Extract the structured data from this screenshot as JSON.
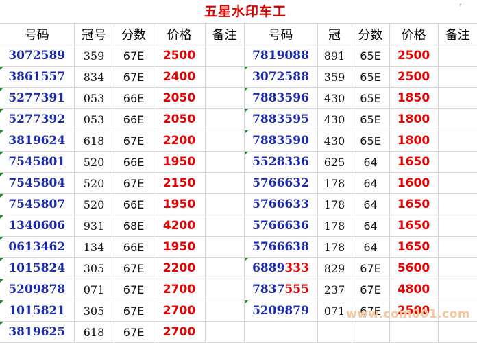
{
  "title": "五星水印车工",
  "headers_left": [
    "号码",
    "冠号",
    "分数",
    "价格",
    "备注"
  ],
  "headers_right": [
    "号码",
    "冠",
    "分数",
    "价格",
    "备注"
  ],
  "left_rows": [
    {
      "number": "3072589",
      "crown": "359",
      "score": "67E",
      "price": "2500"
    },
    {
      "number": "3861557",
      "crown": "834",
      "score": "67E",
      "price": "2400"
    },
    {
      "number": "5277391",
      "crown": "053",
      "score": "66E",
      "price": "2050"
    },
    {
      "number": "5277392",
      "crown": "053",
      "score": "66E",
      "price": "2050"
    },
    {
      "number": "3819624",
      "crown": "618",
      "score": "67E",
      "price": "2200"
    },
    {
      "number": "7545801",
      "crown": "520",
      "score": "66E",
      "price": "1950"
    },
    {
      "number": "7545804",
      "crown": "520",
      "score": "67E",
      "price": "2150"
    },
    {
      "number": "7545807",
      "crown": "520",
      "score": "66E",
      "price": "1950"
    },
    {
      "number": "1340606",
      "crown": "931",
      "score": "68E",
      "price": "4200"
    },
    {
      "number": "0613462",
      "crown": "134",
      "score": "66E",
      "price": "1950"
    },
    {
      "number": "1015824",
      "crown": "305",
      "score": "67E",
      "price": "2200"
    },
    {
      "number": "5209878",
      "crown": "071",
      "score": "67E",
      "price": "2700"
    },
    {
      "number": "1015821",
      "crown": "305",
      "score": "67E",
      "price": "2700"
    },
    {
      "number": "3819625",
      "crown": "618",
      "score": "67E",
      "price": "2700"
    }
  ],
  "right_rows": [
    {
      "number_a": "7819088",
      "number_b": "",
      "crown": "891",
      "score": "65E",
      "price": "2500"
    },
    {
      "number_a": "3072588",
      "number_b": "",
      "crown": "359",
      "score": "65E",
      "price": "2500"
    },
    {
      "number_a": "7883596",
      "number_b": "",
      "crown": "430",
      "score": "65E",
      "price": "1850"
    },
    {
      "number_a": "7883595",
      "number_b": "",
      "crown": "430",
      "score": "65E",
      "price": "1800"
    },
    {
      "number_a": "7883590",
      "number_b": "",
      "crown": "430",
      "score": "65E",
      "price": "1800"
    },
    {
      "number_a": "5528336",
      "number_b": "",
      "crown": "625",
      "score": "64",
      "price": "1650"
    },
    {
      "number_a": "5766632",
      "number_b": "",
      "crown": "178",
      "score": "64",
      "price": "1600"
    },
    {
      "number_a": "5766633",
      "number_b": "",
      "crown": "178",
      "score": "64",
      "price": "1650"
    },
    {
      "number_a": "5766636",
      "number_b": "",
      "crown": "178",
      "score": "64",
      "price": "1650"
    },
    {
      "number_a": "5766638",
      "number_b": "",
      "crown": "178",
      "score": "64",
      "price": "1650"
    },
    {
      "number_a": "6889",
      "number_b": "333",
      "crown": "829",
      "score": "67E",
      "price": "5600"
    },
    {
      "number_a": "7837",
      "number_b": "555",
      "crown": "237",
      "score": "67E",
      "price": "4800"
    },
    {
      "number_a": "5209879",
      "number_b": "",
      "crown": "071",
      "score": "67E",
      "price": "2500"
    },
    {
      "number_a": "",
      "number_b": "",
      "crown": "",
      "score": "",
      "price": ""
    }
  ],
  "watermark": "www.coin001.com",
  "colors": {
    "title": "#d40000",
    "number": "#1a2aa8",
    "price": "#e00000",
    "marker": "#1e8a2e",
    "watermark": "#f7c79e"
  }
}
